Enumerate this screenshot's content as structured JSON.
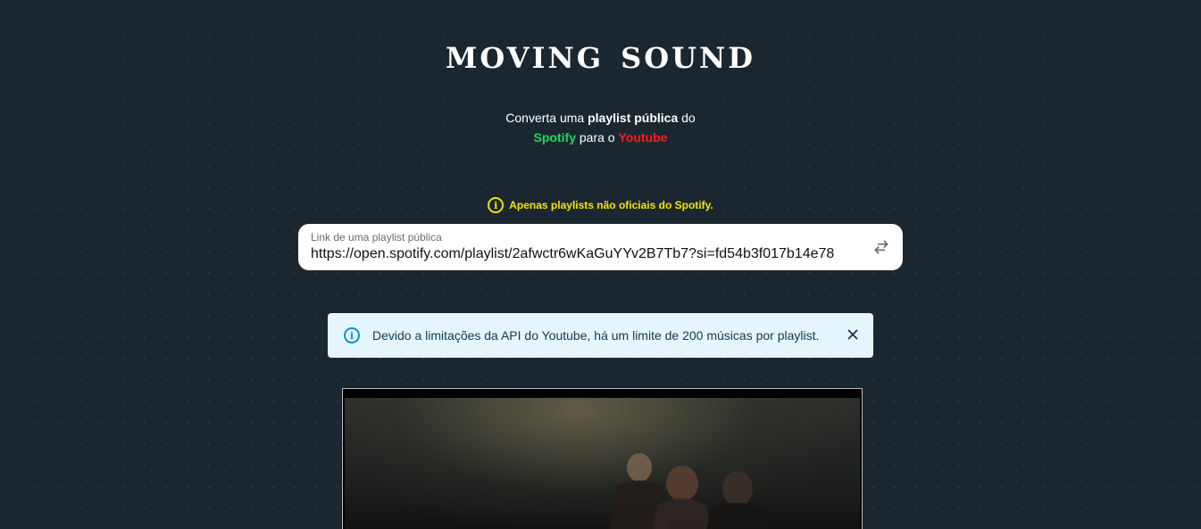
{
  "header": {
    "logo": "moving sound"
  },
  "tagline": {
    "part1": "Converta uma ",
    "bold": "playlist pública",
    "part2": " do",
    "spotify": "Spotify",
    "middle": " para o ",
    "youtube": "Youtube"
  },
  "notice": {
    "icon": "info-icon",
    "text": "Apenas playlists não oficiais do Spotify."
  },
  "playlist_input": {
    "label": "Link de uma playlist pública",
    "value": "https://open.spotify.com/playlist/2afwctr6wKaGuYYv2B7Tb7?si=fd54b3f017b14e78",
    "action_icon": "swap-arrows-icon"
  },
  "alert": {
    "icon": "info-icon",
    "text": "Devido a limitações da API do Youtube, há um limite de 200 músicas por playlist.",
    "close_icon": "close-icon"
  },
  "colors": {
    "background": "#1a2731",
    "spotify": "#1ed760",
    "youtube": "#ff1a1a",
    "warning": "#f2e600",
    "alert_bg": "#e5f5fc",
    "alert_accent": "#0b8fd0"
  }
}
